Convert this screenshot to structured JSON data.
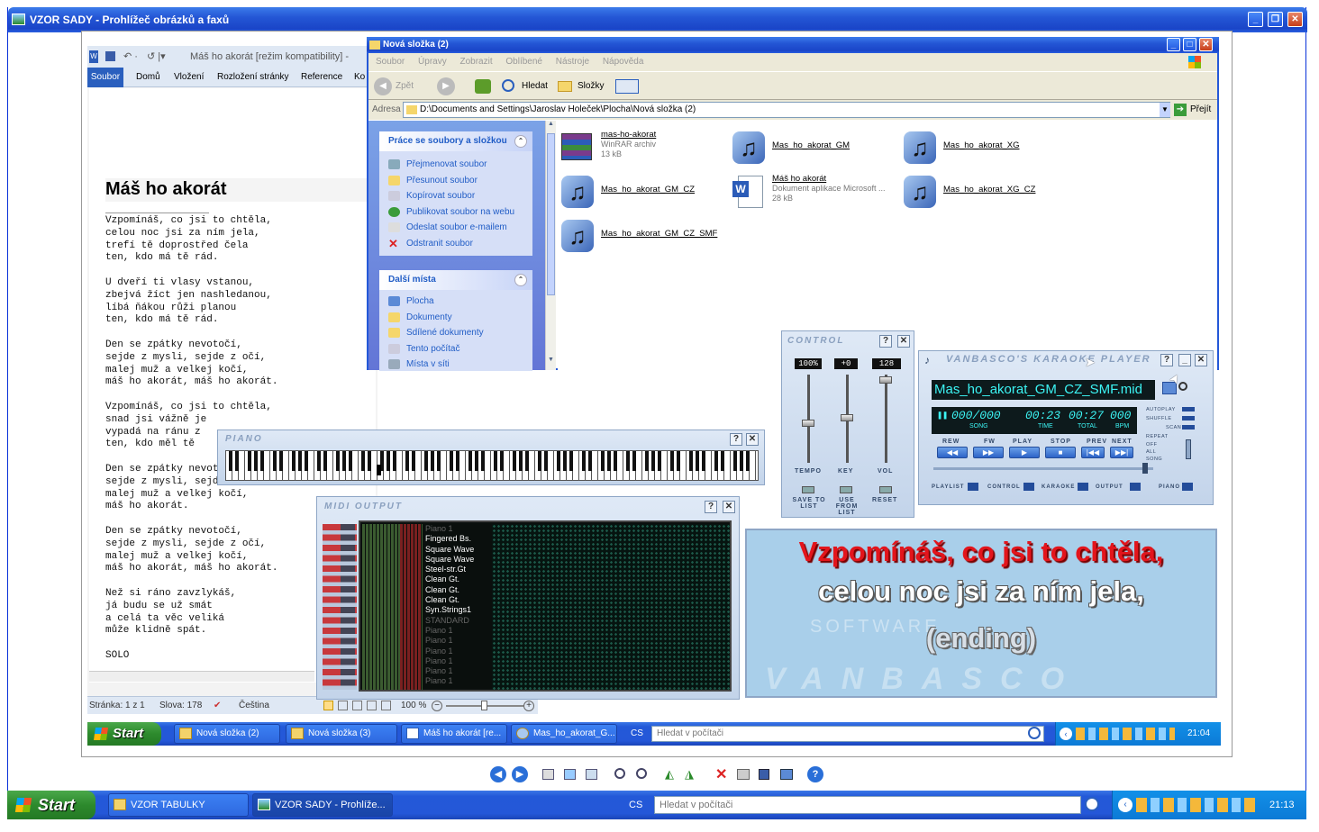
{
  "viewer": {
    "title": "VZOR SADY - Prohlížeč obrázků a faxů"
  },
  "word": {
    "qa_title": "Máš ho akorát [režim kompatibility] -",
    "tabs": [
      "Soubor",
      "Domů",
      "Vložení",
      "Rozložení stránky",
      "Reference",
      "Ko"
    ],
    "heading": "Máš ho akorát",
    "lyrics": "Vzpomínáš, co jsi to chtěla,\ncelou noc jsi za ním jela,\ntrefí tě doprostřed čela\nten, kdo má tě rád.\n\nU dveří ti vlasy vstanou,\nzbejvá žíct jen nashledanou,\nlíbá ňákou růži planou\nten, kdo má tě rád.\n\nDen se zpátky nevotočí,\nsejde z mysli, sejde z očí,\nmalej muž a velkej kočí,\nmáš ho akorát, máš ho akorát.\n\nVzpomínáš, co jsi to chtěla,\nsnad jsi vážně je\nvypadá na ránu z\nten, kdo měl tě\n\nDen se zpátky nevotočí,\nsejde z mysli, sejde z očí,\nmalej muž a velkej kočí,\nmáš ho akorát.\n\nDen se zpátky nevotočí,\nsejde z mysli, sejde z očí,\nmalej muž a velkej kočí,\nmáš ho akorát, máš ho akorát.\n\nNež si ráno zavzlykáš,\njá budu se už smát\na celá ta věc veliká\nmůže klidně spát.\n\nSOLO",
    "status_page": "Stránka: 1 z 1",
    "status_words": "Slova: 178",
    "status_lang": "Čeština",
    "zoom": "100 %"
  },
  "explorer": {
    "title": "Nová složka (2)",
    "menu": [
      "Soubor",
      "Úpravy",
      "Zobrazit",
      "Oblíbené",
      "Nástroje",
      "Nápověda"
    ],
    "back": "Zpět",
    "search": "Hledat",
    "folders": "Složky",
    "address_label": "Adresa",
    "address": "D:\\Documents and Settings\\Jaroslav Holeček\\Plocha\\Nová složka (2)",
    "go": "Přejít",
    "tasks_header": "Práce se soubory a složkou",
    "tasks": [
      "Přejmenovat soubor",
      "Přesunout soubor",
      "Kopírovat soubor",
      "Publikovat soubor na webu",
      "Odeslat soubor e-mailem",
      "Odstranit soubor"
    ],
    "places_header": "Další místa",
    "places": [
      "Plocha",
      "Dokumenty",
      "Sdílené dokumenty",
      "Tento počítač",
      "Místa v síti"
    ],
    "files": [
      {
        "name": "mas-ho-akorat",
        "desc1": "WinRAR archiv",
        "desc2": "13 kB"
      },
      {
        "name": "Mas_ho_akorat_GM",
        "desc1": "",
        "desc2": ""
      },
      {
        "name": "Mas_ho_akorat_XG",
        "desc1": "",
        "desc2": ""
      },
      {
        "name": "Mas_ho_akorat_GM_CZ",
        "desc1": "",
        "desc2": ""
      },
      {
        "name": "Máš ho akorát",
        "desc1": "Dokument aplikace Microsoft ...",
        "desc2": "28 kB"
      },
      {
        "name": "Mas_ho_akorat_XG_CZ",
        "desc1": "",
        "desc2": ""
      },
      {
        "name": "Mas_ho_akorat_GM_CZ_SMF",
        "desc1": "",
        "desc2": ""
      }
    ]
  },
  "control": {
    "title": "CONTROL",
    "tempo": "100%",
    "key": "+0",
    "vol": "128",
    "labels": [
      "TEMPO",
      "KEY",
      "VOL"
    ],
    "save": "SAVE TO LIST",
    "use": "USE FROM LIST",
    "reset": "RESET"
  },
  "karaoke": {
    "title": "VANBASCO'S KARAOKE PLAYER",
    "file": "Mas_ho_akorat_GM_CZ_SMF.mid",
    "song": "000/000",
    "time": "00:23",
    "total": "00:27",
    "bpm": "000",
    "lbl_song": "SONG",
    "lbl_time": "TIME",
    "lbl_total": "TOTAL",
    "lbl_bpm": "BPM",
    "buttons": [
      "REW",
      "FW",
      "PLAY",
      "STOP",
      "PREV",
      "NEXT"
    ],
    "side": [
      "AUTOPLAY",
      "SHUFFLE",
      "SCAN",
      "REPEAT",
      "OFF",
      "ALL",
      "SONG"
    ],
    "bottom": [
      "PLAYLIST",
      "CONTROL",
      "KARAOKE",
      "OUTPUT",
      "PIANO"
    ]
  },
  "piano": {
    "title": "PIANO"
  },
  "midi": {
    "title": "MIDI OUTPUT",
    "channels": [
      "Piano 1",
      "Fingered Bs.",
      "Square Wave",
      "Square Wave",
      "Steel-str.Gt",
      "Clean Gt.",
      "Clean Gt.",
      "Clean Gt.",
      "Syn.Strings1",
      "STANDARD",
      "Piano 1",
      "Piano 1",
      "Piano 1",
      "Piano 1",
      "Piano 1",
      "Piano 1"
    ]
  },
  "lyrics_display": {
    "line1": "Vzpomínáš, co jsi to chtěla,",
    "line2": "celou noc jsi za ním jela,",
    "line3": "(ending)",
    "watermark": "VANBASCO",
    "watermark2": "SOFTWARE",
    "colors": {
      "sung": "#e3151c",
      "unsung": "#ffffff",
      "bg": "#a9cfea"
    }
  },
  "inner_taskbar": {
    "start": "Start",
    "tasks": [
      "Nová složka (2)",
      "Nová složka (3)",
      "Máš ho akorát [re...",
      "Mas_ho_akorat_G..."
    ],
    "lang": "CS",
    "search_placeholder": "Hledat v počítači",
    "clock": "21:04"
  },
  "outer_taskbar": {
    "start": "Start",
    "tasks": [
      "VZOR TABULKY",
      "VZOR SADY - Prohlíže..."
    ],
    "lang": "CS",
    "search_placeholder": "Hledat v počítači",
    "clock": "21:13"
  },
  "viewer_toolbar": {
    "icons": [
      "prev-image-icon",
      "next-image-icon",
      "best-fit-icon",
      "actual-size-icon",
      "slideshow-icon",
      "zoom-in-icon",
      "zoom-out-icon",
      "rotate-cw-icon",
      "rotate-ccw-icon",
      "delete-icon",
      "print-icon",
      "save-icon",
      "edit-icon",
      "help-icon"
    ]
  }
}
